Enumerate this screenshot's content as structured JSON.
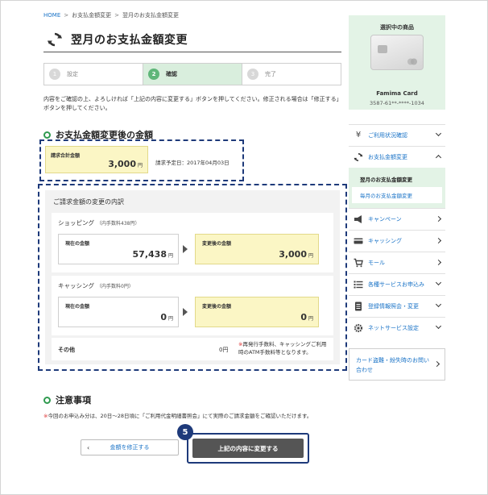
{
  "breadcrumb": {
    "home": "HOME",
    "sep": ">",
    "item1": "お支払金額変更",
    "item2": "翌月のお支払金額変更"
  },
  "page_title": "翌月のお支払金額変更",
  "steps": [
    {
      "num": "1",
      "label": "設定"
    },
    {
      "num": "2",
      "label": "確認"
    },
    {
      "num": "3",
      "label": "完了"
    }
  ],
  "intro": "内容をご確認の上、よろしければ「上記の内容に変更する」ボタンを押してください。修正される場合は「修正する」ボタンを押してください。",
  "section_after": "お支払金額変更後の金額",
  "summary": {
    "label": "請求合計金額",
    "amount": "3,000",
    "unit": "円",
    "bill_date": "請求予定日：2017年04月03日"
  },
  "breakdown": {
    "title": "ご請求金額の変更の内訳",
    "shopping": {
      "title": "ショッピング",
      "fee": "（内手数料438円）",
      "current_label": "現在の金額",
      "current_amount": "57,438",
      "new_label": "変更後の金額",
      "new_amount": "3,000",
      "unit": "円"
    },
    "cashing": {
      "title": "キャッシング",
      "fee": "（内手数料0円）",
      "current_label": "現在の金額",
      "current_amount": "0",
      "new_label": "変更後の金額",
      "new_amount": "0",
      "unit": "円"
    },
    "other": {
      "label": "その他",
      "amount": "0円",
      "note_mark": "※",
      "note": "再発行手数料、キャッシングご利用時のATM手数料等となります。"
    }
  },
  "section_caution": "注意事項",
  "caution": {
    "mark": "※",
    "text": "今回のお申込み分は、20日〜28日頃に「ご利用代金明細書照会」にて実際のご請求金額をご確認いただけます。"
  },
  "buttons": {
    "back": "金額を修正する",
    "submit": "上記の内容に変更する",
    "badge": "5"
  },
  "card": {
    "heading": "選択中の商品",
    "name": "Famima Card",
    "number": "3587-61**-****-1034"
  },
  "menu": {
    "items": [
      {
        "label": "ご利用状況確認",
        "icon": "yen-icon"
      },
      {
        "label": "お支払金額変更",
        "icon": "refresh-icon"
      },
      {
        "label": "キャンペーン",
        "icon": "megaphone-icon"
      },
      {
        "label": "キャッシング",
        "icon": "card-icon"
      },
      {
        "label": "モール",
        "icon": "cart-icon"
      },
      {
        "label": "各種サービスお申込み",
        "icon": "list-icon"
      },
      {
        "label": "登録情報照会・変更",
        "icon": "document-icon"
      },
      {
        "label": "ネットサービス設定",
        "icon": "gear-icon"
      }
    ],
    "sub": {
      "current": "翌月のお支払金額変更",
      "link": "毎月のお支払金額変更"
    }
  },
  "help": {
    "text": "カード盗難・紛失時のお問い合わせ"
  },
  "colors": {
    "accent_green": "#2f9a4f",
    "highlight_yellow": "#fbf6c5",
    "link_blue": "#1a73c7",
    "annotation_navy": "#1e3a7a"
  }
}
